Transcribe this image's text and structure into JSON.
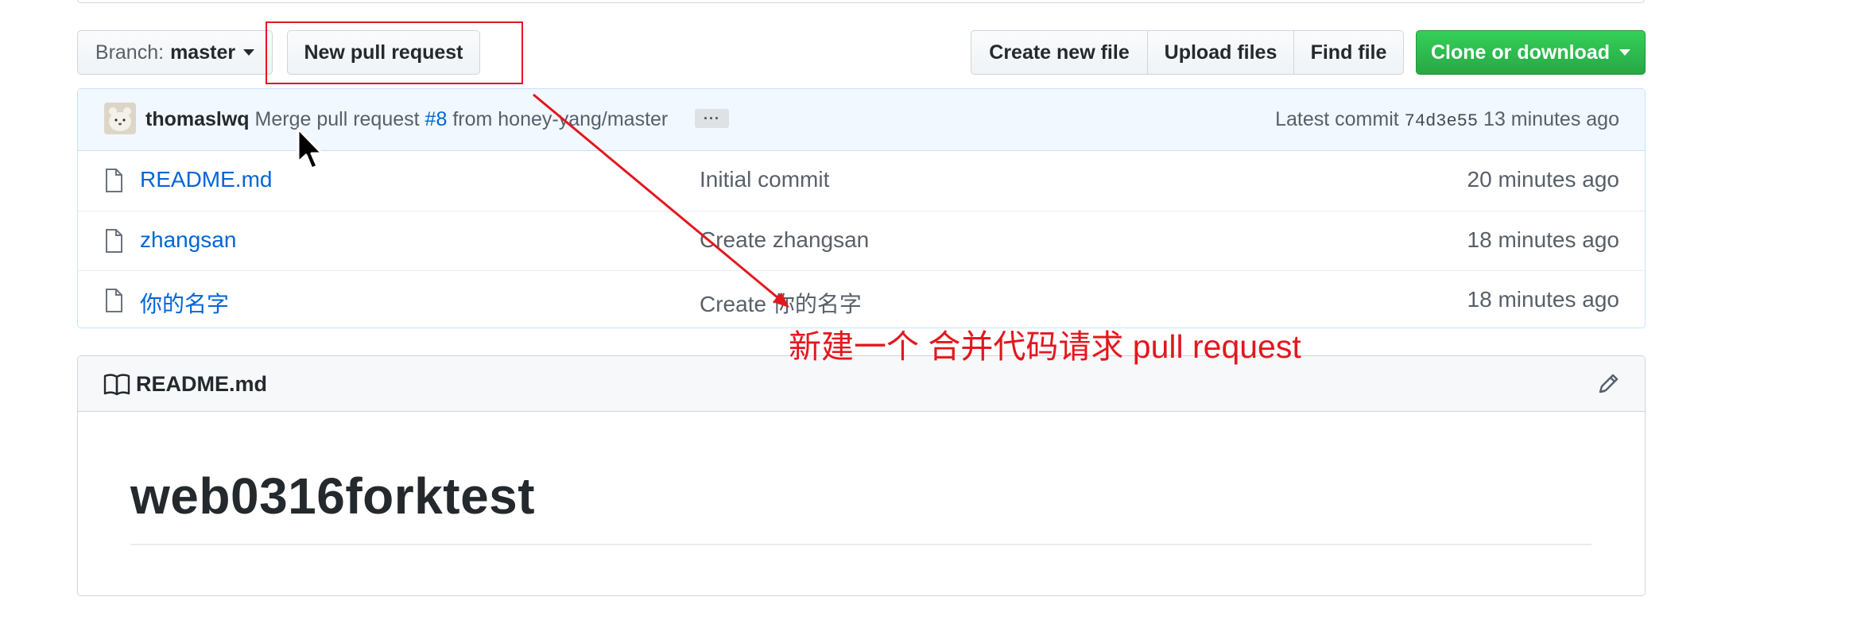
{
  "toolbar": {
    "branch_prefix": "Branch: ",
    "branch_name": "master",
    "new_pull_request": "New pull request",
    "create_new_file": "Create new file",
    "upload_files": "Upload files",
    "find_file": "Find file",
    "clone_or_download": "Clone or download"
  },
  "commit": {
    "author": "thomaslwq",
    "message_prefix": "Merge pull request",
    "pr_number": "#8",
    "message_suffix": "from honey-yang/master",
    "ellipsis": "···",
    "latest_label": "Latest commit",
    "sha": "74d3e55",
    "age": "13 minutes ago"
  },
  "files": [
    {
      "name": "README.md",
      "message": "Initial commit",
      "age": "20 minutes ago"
    },
    {
      "name": "zhangsan",
      "message": "Create zhangsan",
      "age": "18 minutes ago"
    },
    {
      "name": "你的名字",
      "message": "Create 你的名字",
      "age": "18 minutes ago"
    }
  ],
  "readme": {
    "title": "README.md",
    "heading": "web0316forktest"
  },
  "annotation": {
    "text": "新建一个 合并代码请求 pull request",
    "color": "#e3171e"
  },
  "colors": {
    "link": "#0366d6",
    "clone_green": "#28a745",
    "commit_bar_bg": "#f1f8ff"
  }
}
